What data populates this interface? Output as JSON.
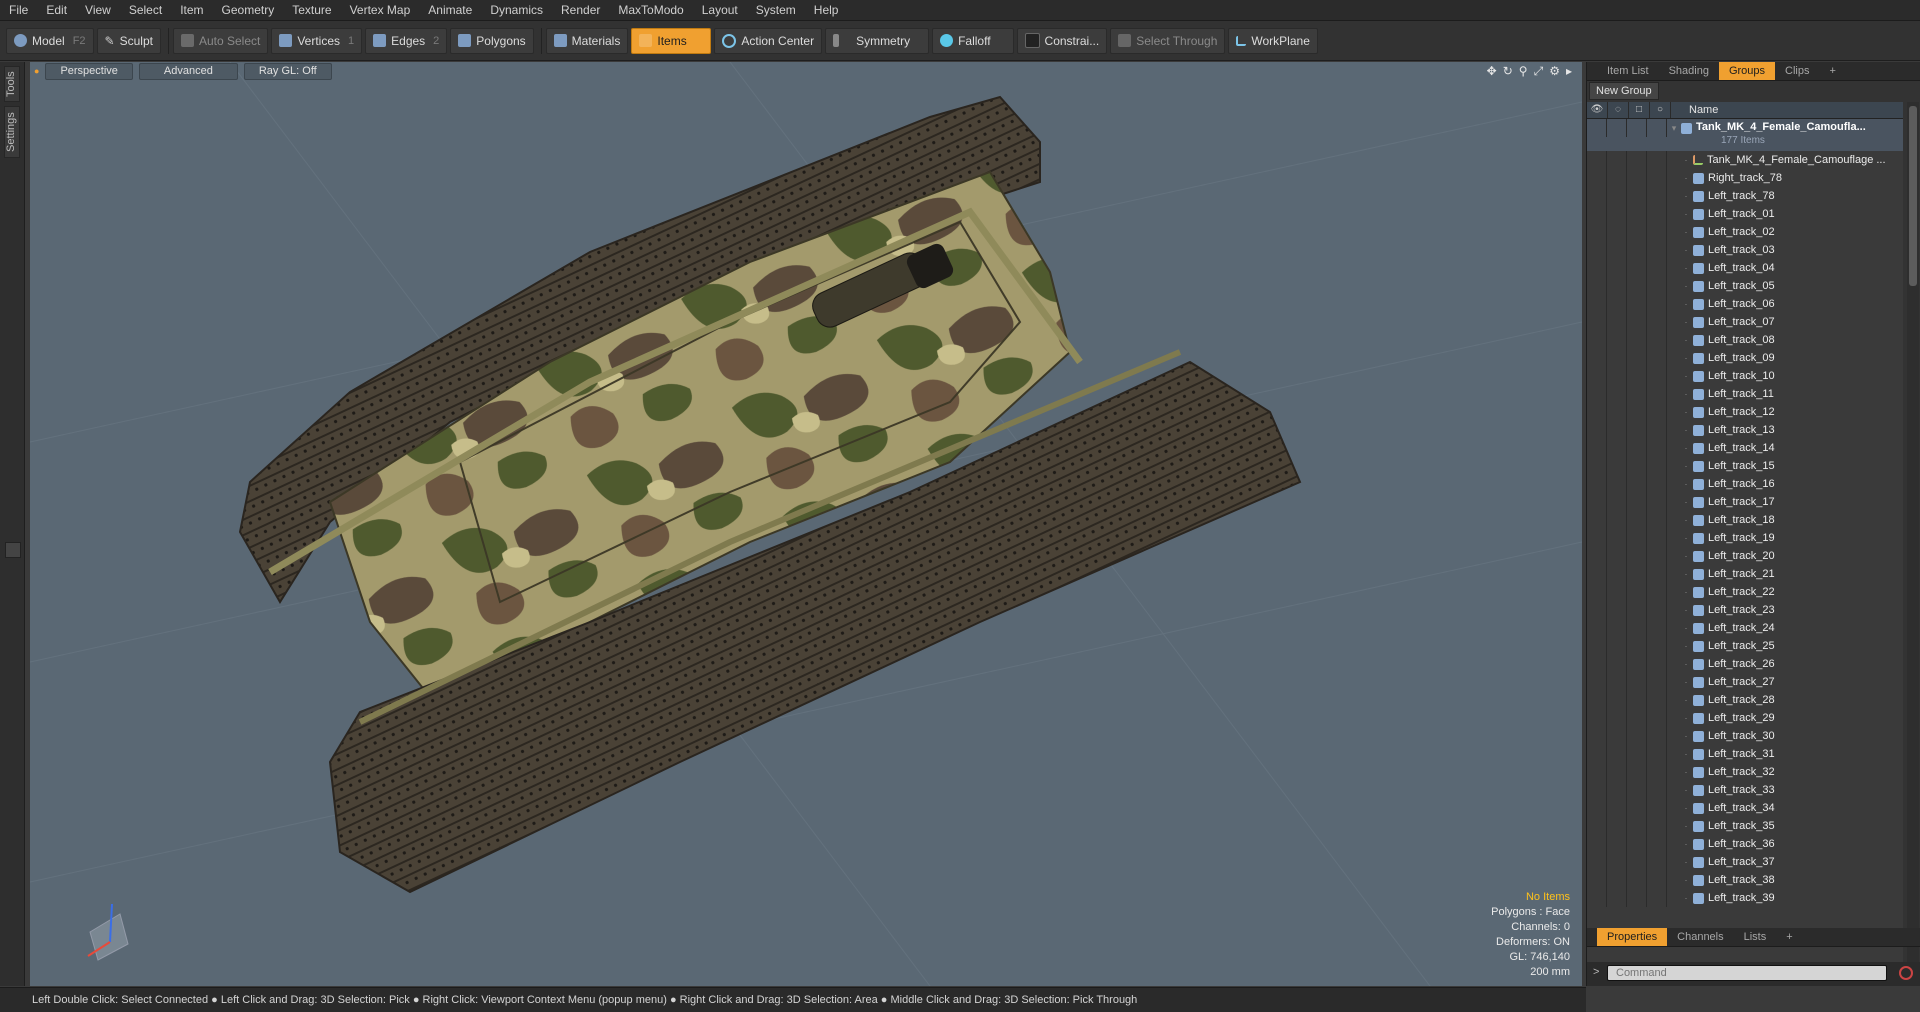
{
  "menu": [
    "File",
    "Edit",
    "View",
    "Select",
    "Item",
    "Geometry",
    "Texture",
    "Vertex Map",
    "Animate",
    "Dynamics",
    "Render",
    "MaxToModo",
    "Layout",
    "System",
    "Help"
  ],
  "toolbar": {
    "model": {
      "label": "Model",
      "key": "F2"
    },
    "sculpt": {
      "label": "Sculpt"
    },
    "auto_select": {
      "label": "Auto Select"
    },
    "vertices": {
      "label": "Vertices",
      "key": "1"
    },
    "edges": {
      "label": "Edges",
      "key": "2"
    },
    "polygons": {
      "label": "Polygons"
    },
    "materials": {
      "label": "Materials"
    },
    "items": {
      "label": "Items"
    },
    "action_center": {
      "label": "Action Center"
    },
    "symmetry": {
      "label": "Symmetry"
    },
    "falloff": {
      "label": "Falloff"
    },
    "constraints": {
      "label": "Constrai..."
    },
    "select_through": {
      "label": "Select Through"
    },
    "workplane": {
      "label": "WorkPlane"
    }
  },
  "left_strip": {
    "tools": "Tools",
    "settings": "Settings"
  },
  "viewport": {
    "perspective": "Perspective",
    "advanced": "Advanced",
    "raygl": "Ray GL: Off",
    "icons": [
      "move-view-icon",
      "rotate-view-icon",
      "zoom-view-icon",
      "maximize-view-icon",
      "settings-icon",
      "arrow-right-icon"
    ],
    "info": {
      "selection": "No Items",
      "polygons": "Polygons : Face",
      "channels": "Channels: 0",
      "deformers": "Deformers: ON",
      "gl": "GL: 746,140",
      "scale": "200 mm"
    }
  },
  "right_panel": {
    "tabs": [
      "Item List",
      "Shading",
      "Groups",
      "Clips"
    ],
    "active_tab": "Groups",
    "add_tab": "+",
    "new_group": "New Group",
    "name_header": "Name",
    "root": {
      "name": "Tank_MK_4_Female_Camoufla...",
      "count": "177 Items"
    },
    "items": [
      "Tank_MK_4_Female_Camouflage ...",
      "Right_track_78",
      "Left_track_78",
      "Left_track_01",
      "Left_track_02",
      "Left_track_03",
      "Left_track_04",
      "Left_track_05",
      "Left_track_06",
      "Left_track_07",
      "Left_track_08",
      "Left_track_09",
      "Left_track_10",
      "Left_track_11",
      "Left_track_12",
      "Left_track_13",
      "Left_track_14",
      "Left_track_15",
      "Left_track_16",
      "Left_track_17",
      "Left_track_18",
      "Left_track_19",
      "Left_track_20",
      "Left_track_21",
      "Left_track_22",
      "Left_track_23",
      "Left_track_24",
      "Left_track_25",
      "Left_track_26",
      "Left_track_27",
      "Left_track_28",
      "Left_track_29",
      "Left_track_30",
      "Left_track_31",
      "Left_track_32",
      "Left_track_33",
      "Left_track_34",
      "Left_track_35",
      "Left_track_36",
      "Left_track_37",
      "Left_track_38",
      "Left_track_39"
    ],
    "bottom_tabs": [
      "Properties",
      "Channels",
      "Lists"
    ],
    "bottom_active": "Properties",
    "command_placeholder": "Command"
  },
  "status_text": "Left Double Click: Select Connected ● Left Click and Drag: 3D Selection: Pick ● Right Click: Viewport Context Menu (popup menu) ● Right Click and Drag: 3D Selection: Area ● Middle Click and Drag: 3D Selection: Pick Through",
  "colors": {
    "accent": "#f0a030",
    "viewport_bg": "#5a6874",
    "info_highlight": "#ffc21a"
  }
}
